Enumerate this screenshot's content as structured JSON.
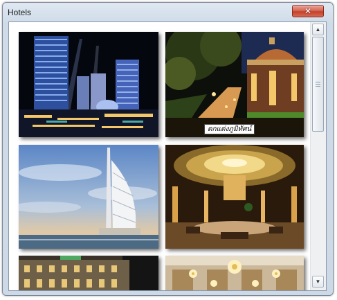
{
  "window": {
    "title": "Hotels",
    "close_glyph": "✕"
  },
  "gallery": {
    "photos": [
      {
        "subject": "night skyline with lit towers"
      },
      {
        "subject": "garden path and domed pavilion at night",
        "caption": "ตกแต่งภูมิทัศน์"
      },
      {
        "subject": "sail-shaped hotel tower at sunset"
      },
      {
        "subject": "grand lobby with golden domed ceiling"
      },
      {
        "subject": "classic facade building at dusk"
      },
      {
        "subject": "ballroom with chandeliers"
      }
    ]
  },
  "scrollbar": {
    "up_icon": "▲",
    "down_icon": "▼"
  },
  "colors": {
    "close_red": "#c4402a",
    "frame": "#cdd9e6"
  }
}
